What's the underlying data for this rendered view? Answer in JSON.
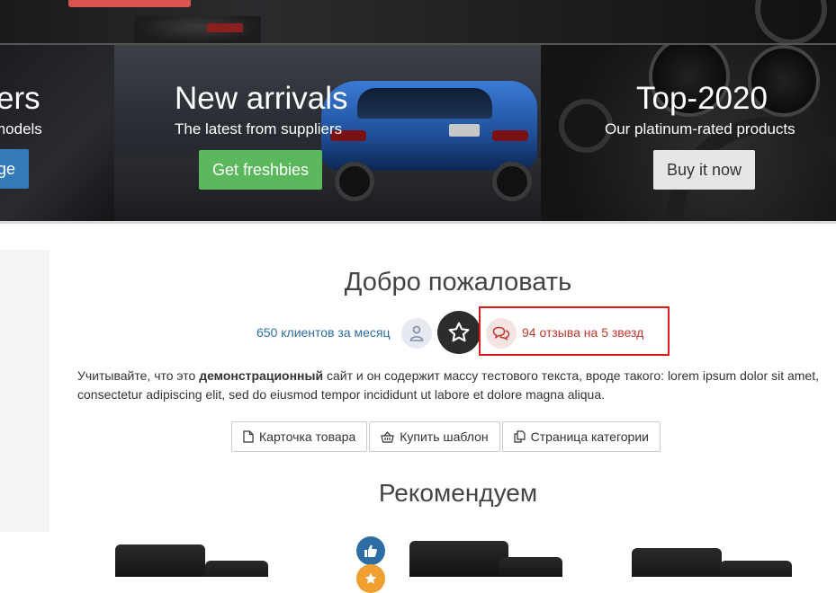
{
  "banners": [
    {
      "title": "ers",
      "subtitle": "models",
      "button": "ge",
      "button_color": "#337ab7"
    },
    {
      "title": "New arrivals",
      "subtitle": "The latest from suppliers",
      "button": "Get freshbies",
      "button_color": "#5cb85c"
    },
    {
      "title": "Top-2020",
      "subtitle": "Our platinum-rated products",
      "button": "Buy it now",
      "button_color": "#e6e6e6"
    }
  ],
  "welcome": {
    "title": "Добро пожаловать",
    "clients_text": "650 клиентов за месяц",
    "reviews_text": "94 отзыва на 5 звезд",
    "description_pre": "Учитывайте, что это ",
    "description_bold": "демонстрационный",
    "description_post": " сайт и он содержит массу тестового текста, вроде такого: lorem ipsum dolor sit amet, consectetur adipiscing elit, sed do eiusmod tempor incididunt ut labore et dolore magna aliqua."
  },
  "actions": [
    {
      "label": "Карточка товара",
      "icon": "file-icon"
    },
    {
      "label": "Купить шаблон",
      "icon": "basket-icon"
    },
    {
      "label": "Страница категории",
      "icon": "copy-icon"
    }
  ],
  "recommend": {
    "title": "Рекомендуем"
  },
  "colors": {
    "accent_blue": "#2e6da4",
    "accent_red": "#c0392b",
    "highlight": "#e01a1a",
    "badge_orange": "#f0a030"
  }
}
